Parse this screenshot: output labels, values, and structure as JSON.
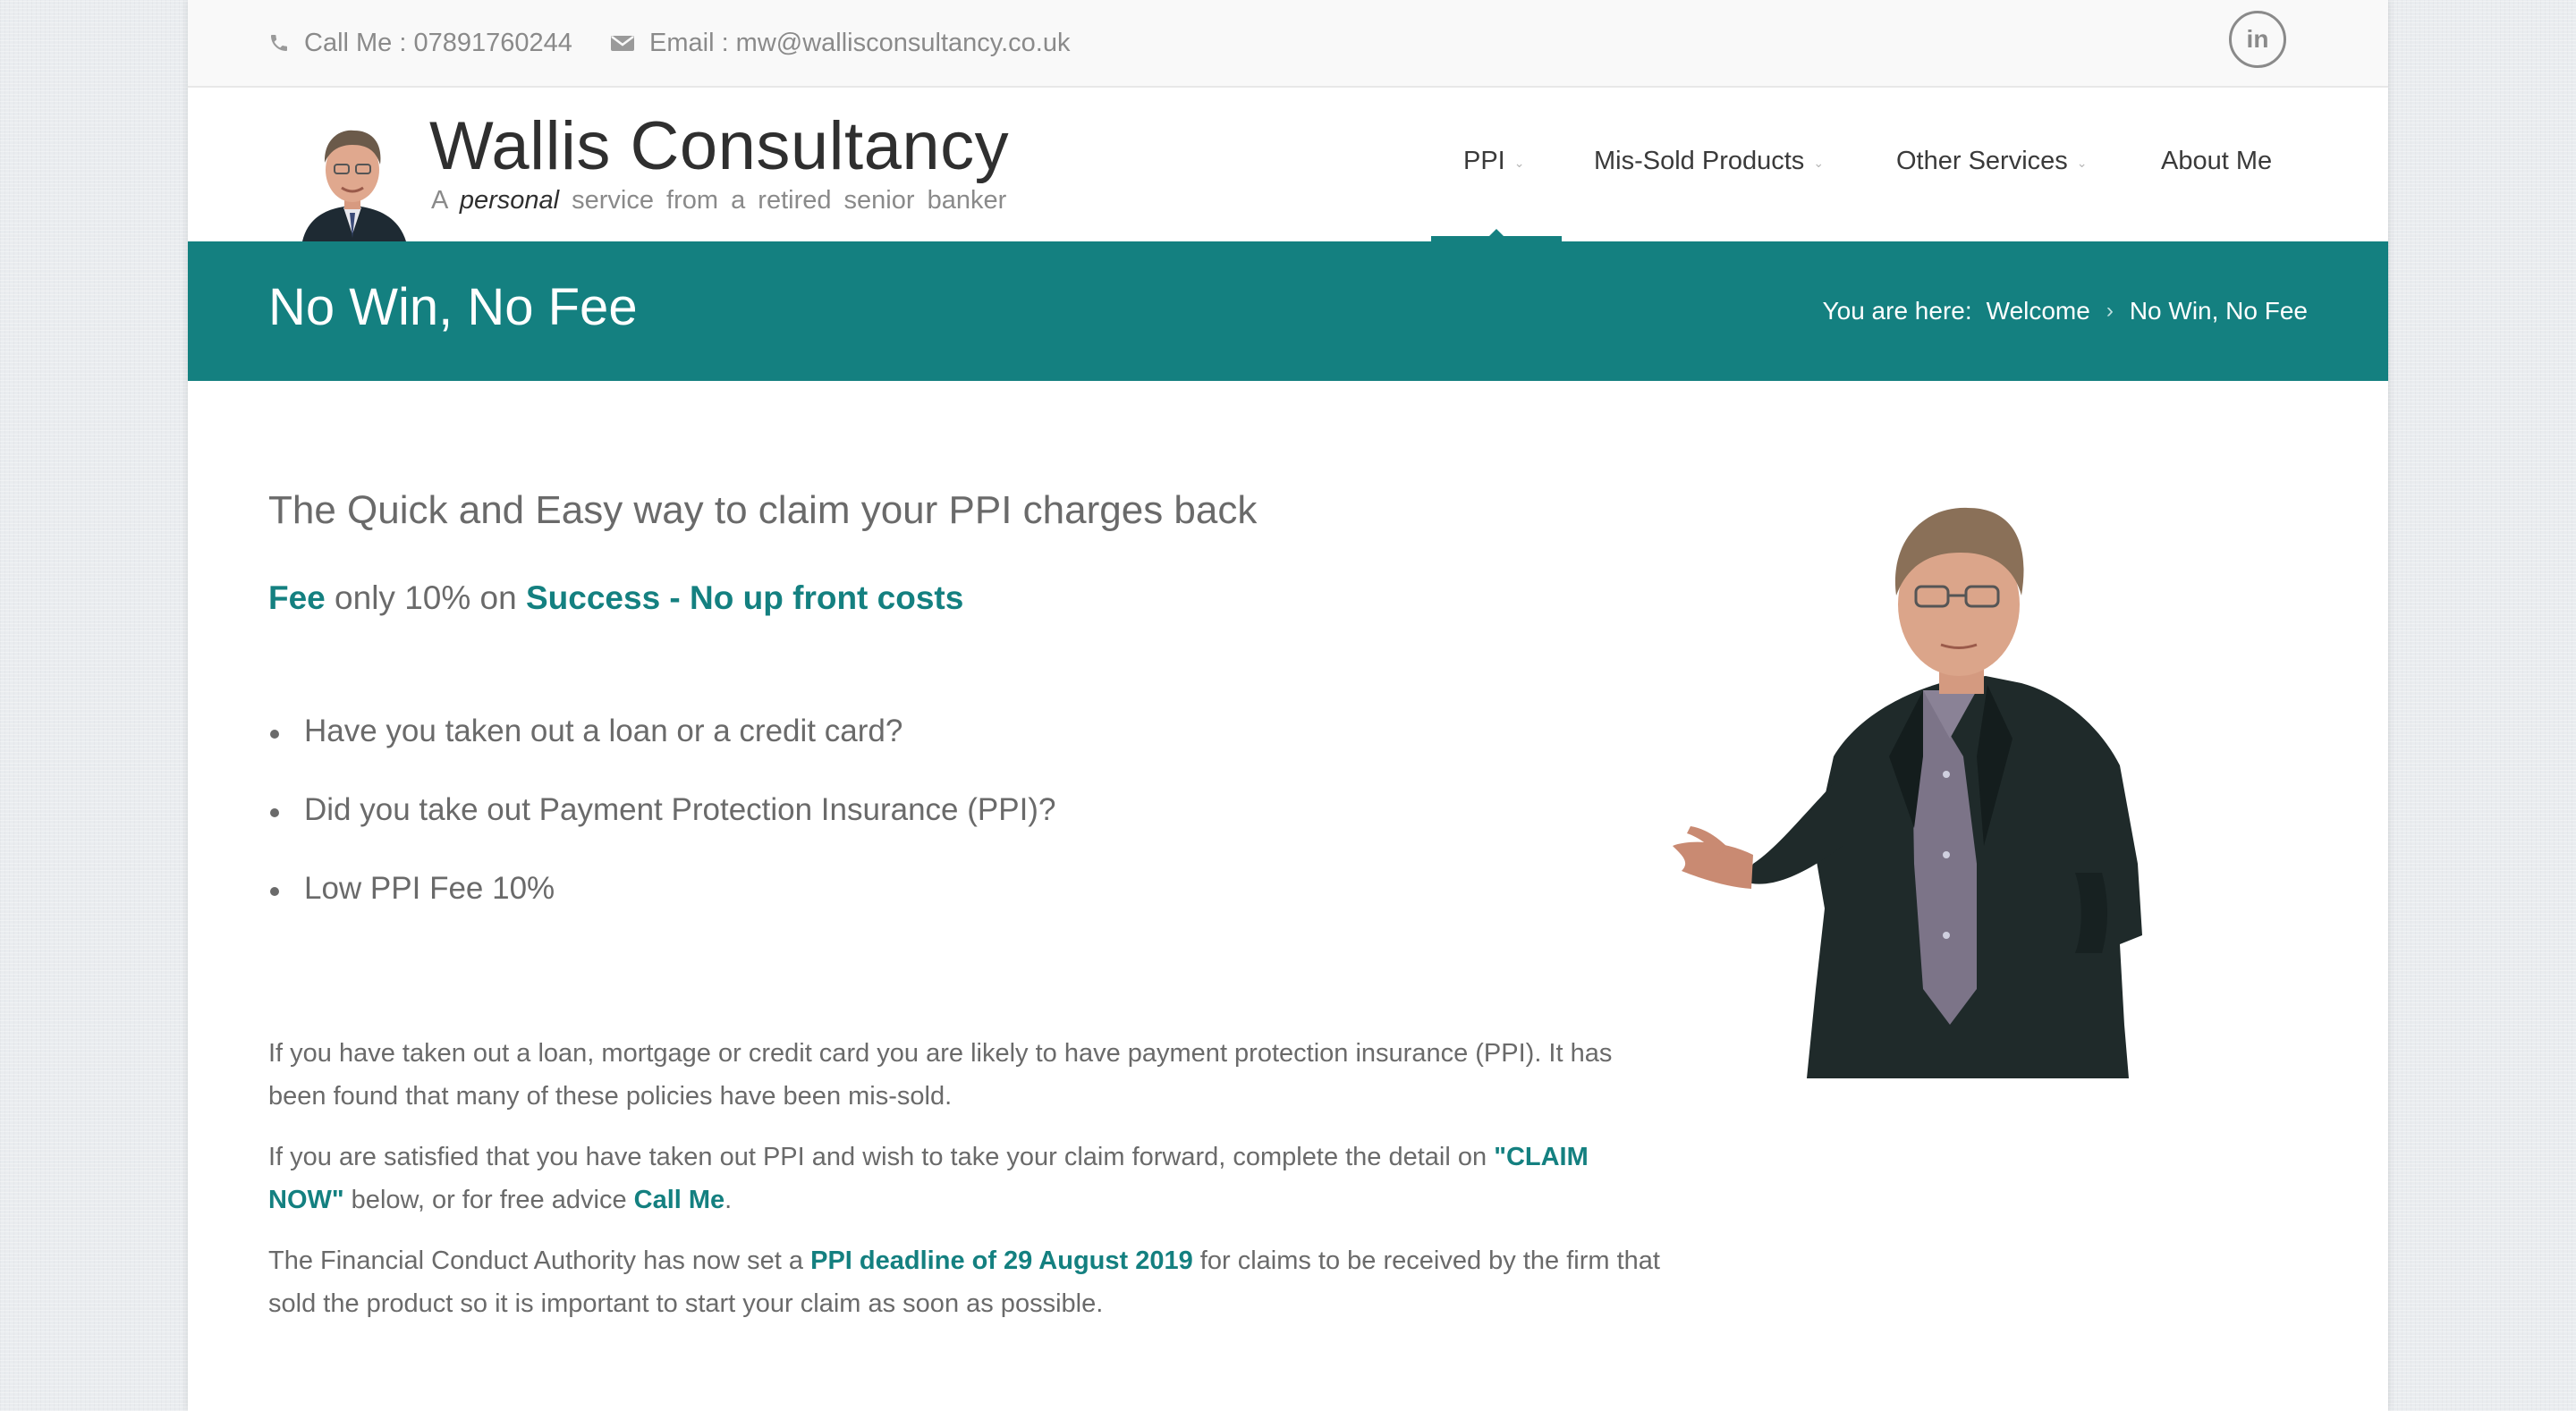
{
  "topbar": {
    "phone_label": "Call Me : 07891760244",
    "email_label": "Email : mw@wallisconsultancy.co.uk",
    "social_icon": "linkedin-icon",
    "social_text": "in"
  },
  "site": {
    "title": "Wallis Consultancy",
    "tagline_prefix": "A",
    "tagline_emphasis": "personal",
    "tagline_rest": "service from a retired senior banker"
  },
  "nav": {
    "items": [
      {
        "label": "PPI",
        "has_dropdown": true,
        "active": true
      },
      {
        "label": "Mis-Sold Products",
        "has_dropdown": true,
        "active": false
      },
      {
        "label": "Other Services",
        "has_dropdown": true,
        "active": false
      },
      {
        "label": "About Me",
        "has_dropdown": false,
        "active": false
      }
    ]
  },
  "title_bar": {
    "page_title": "No Win, No Fee",
    "breadcrumb_label": "You are here:",
    "breadcrumb_home": "Welcome",
    "breadcrumb_separator": "›",
    "breadcrumb_current": "No Win, No Fee"
  },
  "content": {
    "heading": "The Quick and Easy way to claim your PPI charges back",
    "fee_line": {
      "fee": "Fee",
      "middle": "only 10% on",
      "success": "Success - No up front costs"
    },
    "bullets": [
      "Have you taken out a loan or a credit card?",
      "Did you take out Payment Protection Insurance (PPI)?",
      "Low PPI Fee 10%"
    ],
    "paragraph1": "If you have taken out a loan, mortgage or credit card you are likely to have payment protection insurance (PPI). It has been found that many of these policies have been mis-sold.",
    "paragraph2": {
      "before": "If you are satisfied that you have taken out PPI and wish to take your claim forward, complete the detail on ",
      "claim_link": "\"CLAIM NOW\"",
      "middle": " below, or for free advice ",
      "call_link": "Call Me",
      "after": "."
    },
    "paragraph3": {
      "before": "The Financial Conduct Authority has now set a ",
      "deadline_link": "PPI deadline of 29 August 2019",
      "after": " for claims to be received by the firm that sold the product so it is important to start your claim as soon as possible."
    }
  },
  "colors": {
    "accent": "#148080",
    "text": "#6a6a6a",
    "title_text": "#2f2f2f"
  }
}
